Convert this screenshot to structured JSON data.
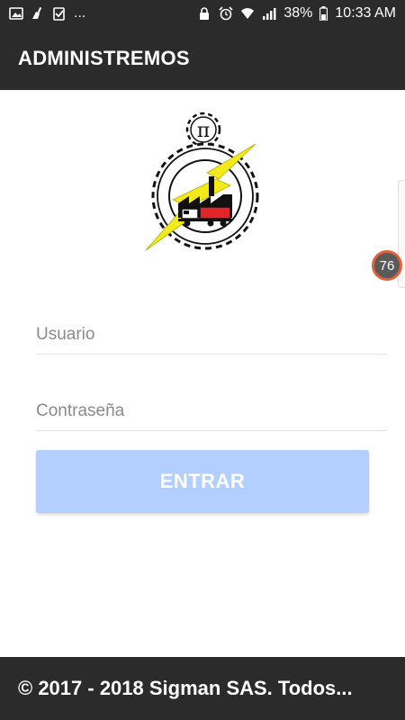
{
  "status_bar": {
    "left_icons": [
      "image-icon",
      "cleaner-icon",
      "clipboard-check-icon"
    ],
    "more": "...",
    "right_icons": [
      "lock-icon",
      "alarm-icon",
      "wifi-icon",
      "signal-icon"
    ],
    "battery_percent": "38%",
    "battery_icon": "battery-icon",
    "time": "10:33 AM"
  },
  "app_bar": {
    "title": "ADMINISTREMOS"
  },
  "logo": {
    "symbol": "π",
    "icon": "company-logo-gear-factory-lightning"
  },
  "form": {
    "username_placeholder": "Usuario",
    "password_placeholder": "Contraseña",
    "submit_label": "ENTRAR"
  },
  "overlay": {
    "bubble_count": "76"
  },
  "footer": {
    "text": "© 2017 - 2018 Sigman SAS. Todos..."
  },
  "colors": {
    "bar_background": "#2b2b2b",
    "button_background": "#b3cfff",
    "logo_yellow": "#f2ea1c",
    "logo_red": "#e3242b",
    "bubble_border": "#e0623a"
  }
}
